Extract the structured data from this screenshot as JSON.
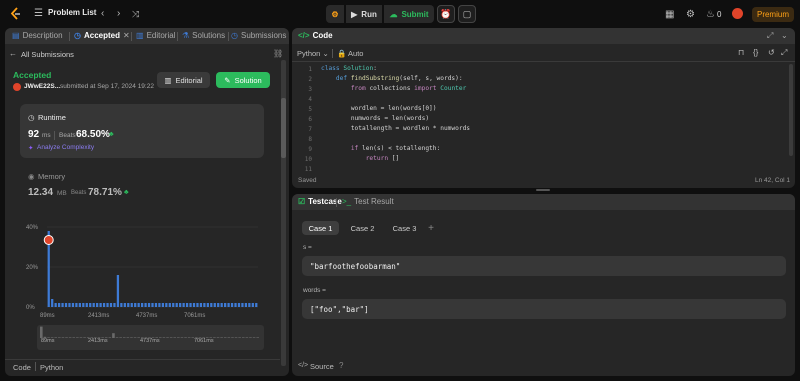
{
  "topbar": {
    "problem_list": "Problem List",
    "run": "Run",
    "submit": "Submit",
    "streak": "0",
    "premium": "Premium"
  },
  "left_tabs": {
    "description": "Description",
    "accepted": "Accepted",
    "editorial": "Editorial",
    "solutions": "Solutions",
    "submissions": "Submissions"
  },
  "submission": {
    "back": "All Submissions",
    "status": "Accepted",
    "user": "JWwE22S...",
    "submitted": "submitted at Sep 17, 2024 19:22",
    "editorial_btn": "Editorial",
    "solution_btn": "Solution"
  },
  "runtime": {
    "title": "Runtime",
    "value": "92",
    "unit": "ms",
    "beats_label": "Beats",
    "beats": "68.50%",
    "analyze": "Analyze Complexity"
  },
  "memory": {
    "title": "Memory",
    "value": "12.34",
    "unit": "MB",
    "beats_label": "Beats",
    "beats": "78.71%"
  },
  "chart_data": {
    "type": "bar",
    "ylim": [
      0,
      40
    ],
    "yticks": [
      "40%",
      "20%",
      "0%"
    ],
    "xticks": [
      "89ms",
      "2413ms",
      "4737ms",
      "7061ms"
    ],
    "values": [
      38,
      4,
      2,
      2,
      2,
      2,
      2,
      2,
      2,
      2,
      2,
      2,
      2,
      2,
      2,
      2,
      2,
      2,
      2,
      2,
      16,
      2,
      2,
      2,
      2,
      2,
      2,
      2,
      2,
      2,
      2,
      2,
      2,
      2,
      2,
      2,
      2,
      2,
      2,
      2,
      2,
      2,
      2,
      2,
      2,
      2,
      2,
      2,
      2,
      2,
      2,
      2,
      2,
      2,
      2,
      2,
      2,
      2,
      2,
      2,
      2
    ],
    "highlight_index": 0,
    "colors": {
      "bar": "#3e7bd6",
      "highlight": "#3e7bd6"
    }
  },
  "minimap_ticks": [
    "89ms",
    "2413ms",
    "4737ms",
    "7061ms"
  ],
  "footer_left": {
    "code": "Code",
    "lang": "Python"
  },
  "code_panel": {
    "title": "Code",
    "lang": "Python",
    "auto": "Auto",
    "saved": "Saved",
    "position": "Ln 42, Col 1",
    "line_numbers": [
      "1",
      "2",
      "3",
      "4",
      "5",
      "6",
      "7",
      "8",
      "9",
      "10",
      "11"
    ]
  },
  "testcase": {
    "tab": "Testcase",
    "result_tab": "Test Result",
    "cases": [
      "Case 1",
      "Case 2",
      "Case 3"
    ],
    "s_label": "s =",
    "s_value": "\"barfoothefoobarman\"",
    "words_label": "words =",
    "words_value": "[\"foo\",\"bar\"]",
    "source": "Source"
  },
  "colors": {
    "accent": "#ffa116",
    "green": "#2cbb5d",
    "blue": "#3e7bd6"
  }
}
